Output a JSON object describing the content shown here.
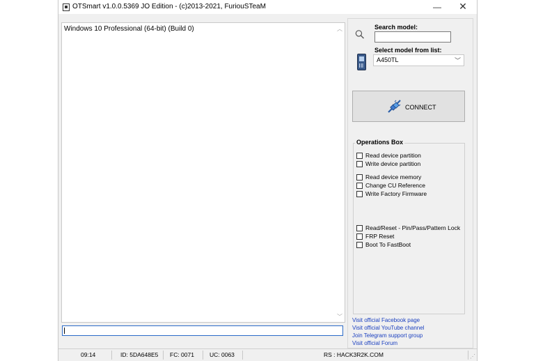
{
  "window": {
    "title": "OTSmart  v1.0.0.5369 JO Edition - (c)2013-2021, FuriouSTeaM",
    "minimize": "—",
    "close": "✕"
  },
  "log": {
    "lines": [
      "Windows 10 Professional (64-bit) (Build 0)"
    ]
  },
  "command_input": {
    "value": ""
  },
  "search": {
    "label": "Search model:",
    "value": ""
  },
  "model": {
    "label": "Select model from list:",
    "selected": "A450TL"
  },
  "connect": {
    "label": "CONNECT"
  },
  "operations": {
    "title": "Operations Box",
    "items": [
      {
        "label": "Read device partition",
        "checked": false
      },
      {
        "label": "Write device partition",
        "checked": false
      },
      {
        "label": "Read device memory",
        "checked": false
      },
      {
        "label": "Change CU Reference",
        "checked": false
      },
      {
        "label": "Write Factory Firmware",
        "checked": false
      },
      {
        "label": "Read/Reset - Pin/Pass/Pattern Lock",
        "checked": false
      },
      {
        "label": "FRP Reset",
        "checked": false
      },
      {
        "label": "Boot To FastBoot",
        "checked": false
      }
    ]
  },
  "links": [
    "Visit official Facebook page",
    "Visit official YouTube channel",
    "Join Telegram support group",
    "Visit official Forum"
  ],
  "status": {
    "time": "09:14",
    "id": "ID: 5DA648E5",
    "fc": "FC: 0071",
    "uc": "UC: 0063",
    "rs": "RS : HACK3R2K.COM"
  },
  "colors": {
    "link": "#1a3fbf",
    "input_focus_border": "#2a6ac8"
  }
}
